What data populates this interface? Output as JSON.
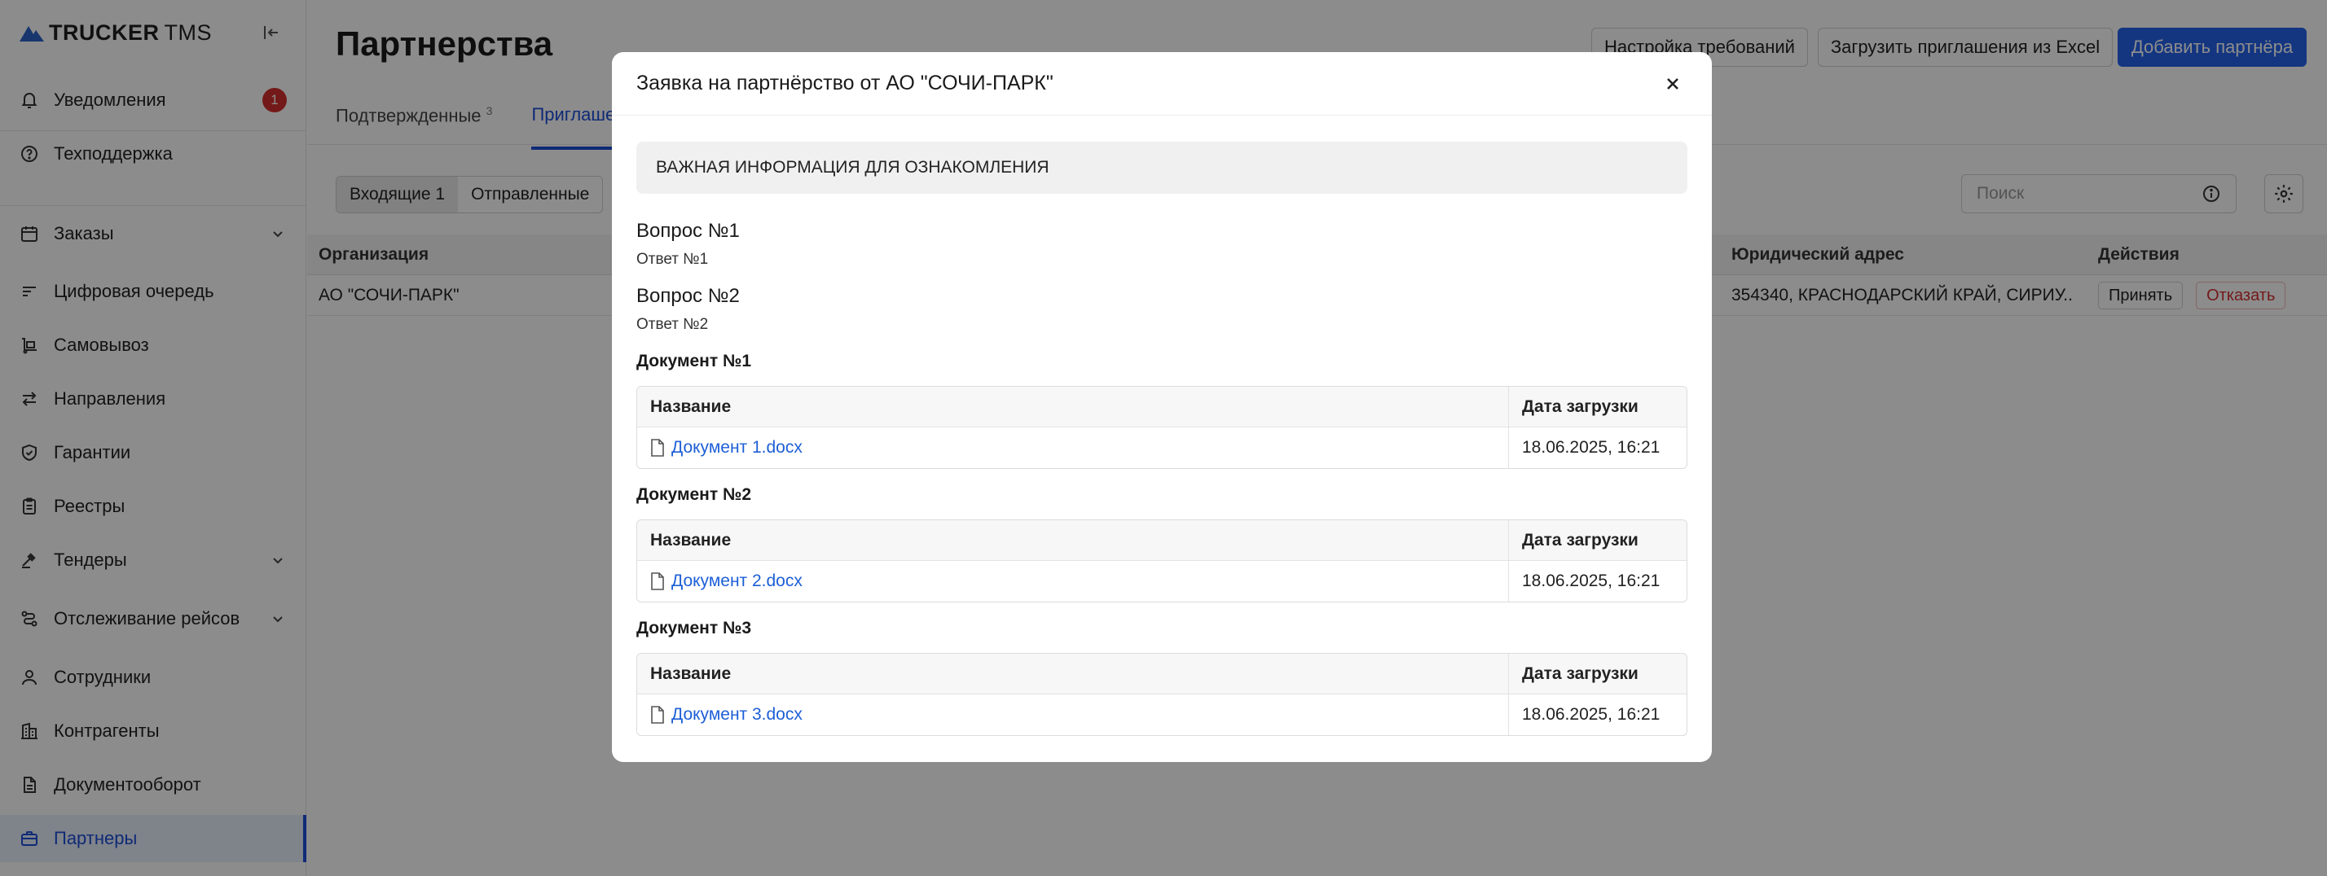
{
  "sidebar": {
    "logo_bold": "TRUCKER",
    "logo_light": "TMS",
    "items": [
      {
        "label": "Уведомления",
        "badge": "1"
      },
      {
        "label": "Техподдержка"
      },
      {
        "label": "Заказы"
      },
      {
        "label": "Цифровая очередь"
      },
      {
        "label": "Самовывоз"
      },
      {
        "label": "Направления"
      },
      {
        "label": "Гарантии"
      },
      {
        "label": "Реестры"
      },
      {
        "label": "Тендеры"
      },
      {
        "label": "Отслеживание рейсов"
      },
      {
        "label": "Сотрудники"
      },
      {
        "label": "Контрагенты"
      },
      {
        "label": "Документооборот"
      },
      {
        "label": "Партнеры"
      }
    ]
  },
  "page": {
    "title": "Партнерства",
    "buttons": {
      "requirements": "Настройка требований",
      "upload": "Загрузить приглашения из Excel",
      "add": "Добавить партнёра"
    },
    "tabs": [
      {
        "label": "Подтвержденные",
        "count": "3"
      },
      {
        "label": "Приглашения"
      }
    ],
    "segments": [
      "Входящие 1",
      "Отправленные"
    ],
    "search_placeholder": "Поиск",
    "table": {
      "headers": {
        "org": "Организация",
        "address": "Юридический адрес",
        "actions": "Действия"
      },
      "row": {
        "org": "АО \"СОЧИ-ПАРК\"",
        "address": "354340, КРАСНОДАРСКИЙ КРАЙ, СИРИУ...",
        "accept": "Принять",
        "decline": "Отказать"
      }
    }
  },
  "modal": {
    "title": "Заявка на партнёрство от АО \"СОЧИ-ПАРК\"",
    "info": "ВАЖНАЯ ИНФОРМАЦИЯ ДЛЯ ОЗНАКОМЛЕНИЯ",
    "questions": [
      {
        "title": "Вопрос №1",
        "answer": "Ответ №1"
      },
      {
        "title": "Вопрос №2",
        "answer": "Ответ №2"
      }
    ],
    "documents": [
      {
        "title": "Документ №1",
        "col_name": "Название",
        "col_date": "Дата загрузки",
        "file": "Документ 1.docx",
        "date": "18.06.2025, 16:21"
      },
      {
        "title": "Документ №2",
        "col_name": "Название",
        "col_date": "Дата загрузки",
        "file": "Документ 2.docx",
        "date": "18.06.2025, 16:21"
      },
      {
        "title": "Документ №3",
        "col_name": "Название",
        "col_date": "Дата загрузки",
        "file": "Документ 3.docx",
        "date": "18.06.2025, 16:21"
      }
    ]
  },
  "colors": {
    "accent": "#2563eb",
    "danger": "#d32f2f",
    "overlay": "rgba(0,0,0,0.45)"
  }
}
